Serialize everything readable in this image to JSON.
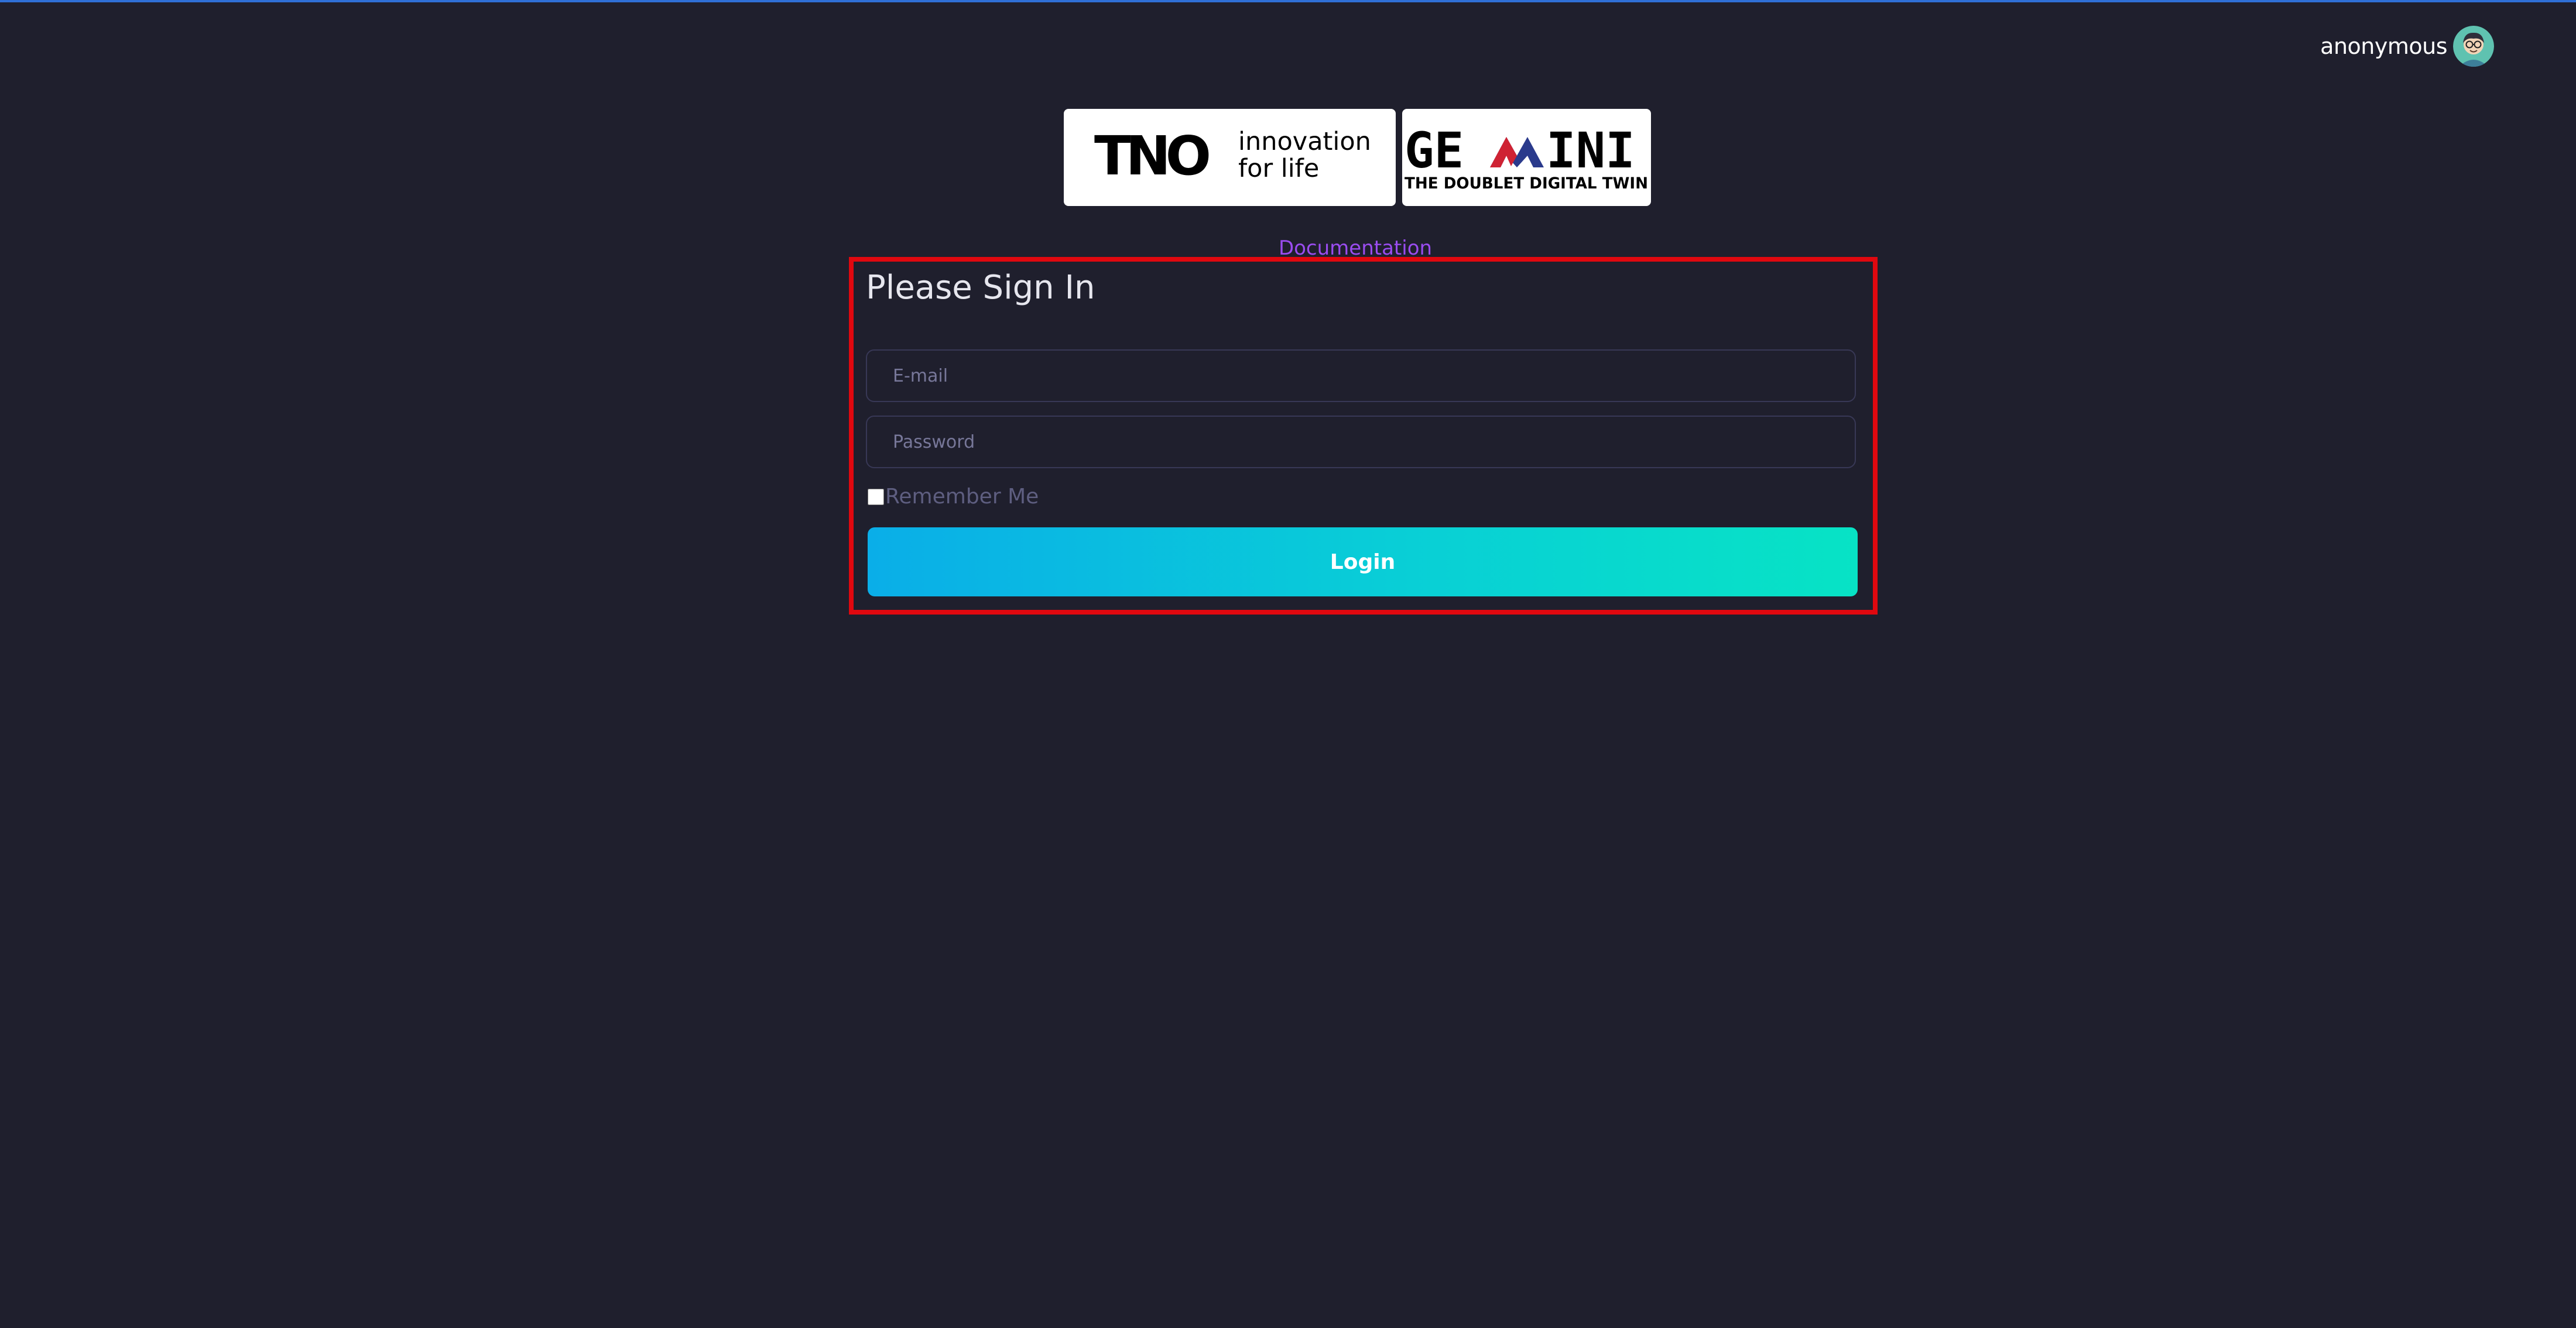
{
  "header": {
    "username": "anonymous"
  },
  "logos": {
    "tno": {
      "wordmark": "TNO",
      "tagline_line1": "innovation",
      "tagline_line2": "for life"
    },
    "gemini": {
      "wordmark_left": "GE",
      "wordmark_right": "INI",
      "subtitle": "THE DOUBLET DIGITAL TWIN"
    }
  },
  "documentation_link": "Documentation",
  "signin": {
    "title": "Please Sign In",
    "email_placeholder": "E-mail",
    "password_placeholder": "Password",
    "remember_label": "Remember Me",
    "remember_checked": false,
    "login_label": "Login"
  },
  "colors": {
    "background": "#1f1f2d",
    "highlight_border": "#e0080f",
    "link": "#9a4cf0",
    "button_gradient_start": "#0aaee8",
    "button_gradient_end": "#07e3c5"
  }
}
